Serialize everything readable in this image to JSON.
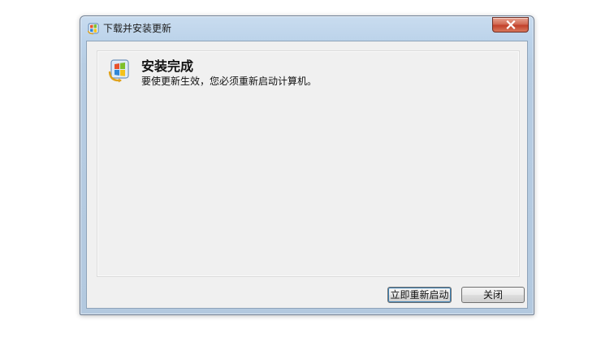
{
  "window": {
    "title": "下载并安装更新",
    "close_icon": "close-icon",
    "app_icon": "windows-update-icon"
  },
  "content": {
    "icon": "windows-update-icon",
    "heading": "安装完成",
    "message": "要使更新生效，您必须重新启动计算机。"
  },
  "buttons": {
    "restart_now": "立即重新启动",
    "close": "关闭"
  },
  "colors": {
    "titlebar": "#bcd3ea",
    "close_button": "#c2412b",
    "client_bg": "#f0f0f0",
    "default_button_focus": "#3c7fb1"
  }
}
